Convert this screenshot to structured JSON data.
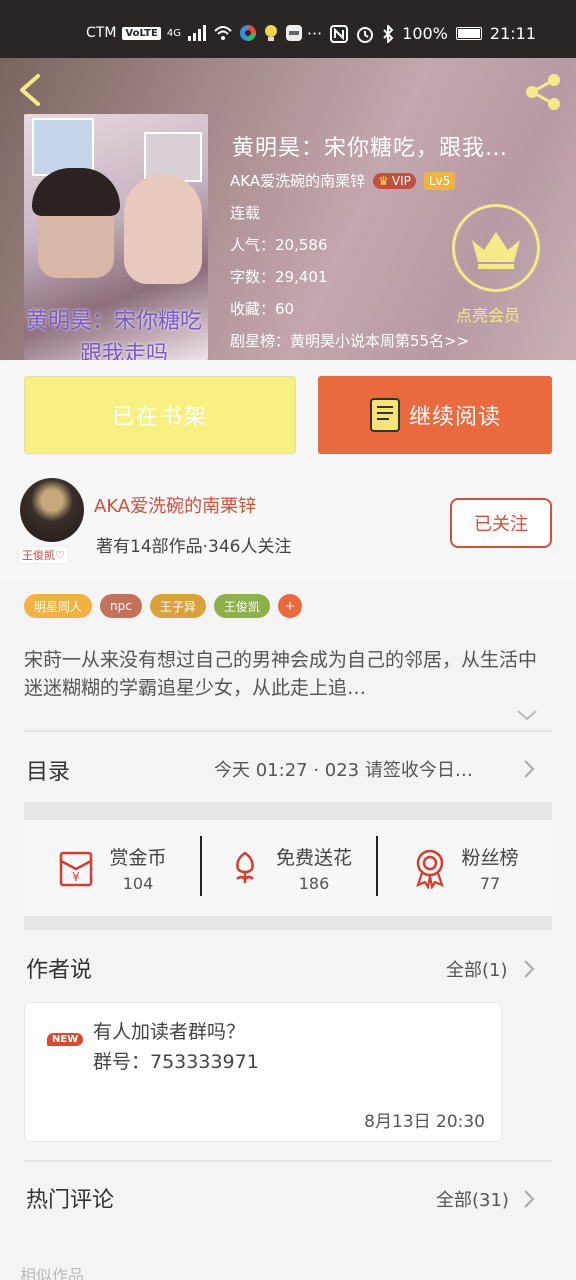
{
  "status_bar": {
    "carrier": "CTM",
    "volte": "VoLTE",
    "network": "4G",
    "battery": "100%",
    "time": "21:11"
  },
  "book": {
    "title": "黄明昊：宋你糖吃，跟我…",
    "author": "AKA爱洗碗的南栗锌",
    "vip_label": "VIP",
    "level": "Lv5",
    "status": "连载",
    "popularity": "人气：20,586",
    "word_count": "字数：29,401",
    "favorites": "收藏：60",
    "ranking": "剧星榜：黄明昊小说本周第55名>>",
    "cover_text_line1": "黄明昊：宋你糖吃",
    "cover_text_line2": "跟我走吗",
    "vip_badge_label": "点亮会员"
  },
  "actions": {
    "shelf_label": "已在书架",
    "read_label": "继续阅读"
  },
  "author": {
    "name": "AKA爱洗碗的南栗锌",
    "stats": "著有14部作品·346人关注",
    "follow_label": "已关注",
    "avatar_tag": "王俊凯♡"
  },
  "tags": [
    {
      "label": "明星同人",
      "color": "#f0b242"
    },
    {
      "label": "npc",
      "color": "#c4735a"
    },
    {
      "label": "王子异",
      "color": "#d9a23a"
    },
    {
      "label": "王俊凯",
      "color": "#8cb04a"
    },
    {
      "label": "+",
      "color": "#ea6a3f"
    }
  ],
  "synopsis": "宋莳一从来没有想过自己的男神会成为自己的邻居，从生活中迷迷糊糊的学霸追星少女，从此走上追…",
  "catalog": {
    "label": "目录",
    "latest": "今天 01:27 · 023 请签收今日…"
  },
  "stats": [
    {
      "label": "赏金币",
      "value": "104",
      "icon": "red-envelope-icon"
    },
    {
      "label": "免费送花",
      "value": "186",
      "icon": "flower-icon"
    },
    {
      "label": "粉丝榜",
      "value": "77",
      "icon": "medal-icon"
    }
  ],
  "author_says": {
    "title": "作者说",
    "more": "全部(1)",
    "new_badge": "NEW",
    "line1": "有人加读者群吗？",
    "line2": "群号：753333971",
    "time": "8月13日 20:30"
  },
  "hot_comments": {
    "title": "热门评论",
    "more": "全部(31)"
  },
  "footer_peek": "相似作品",
  "colors": {
    "accent": "#ea6a3f",
    "author_red": "#d0503d",
    "shelf_yellow": "#f9f082"
  }
}
